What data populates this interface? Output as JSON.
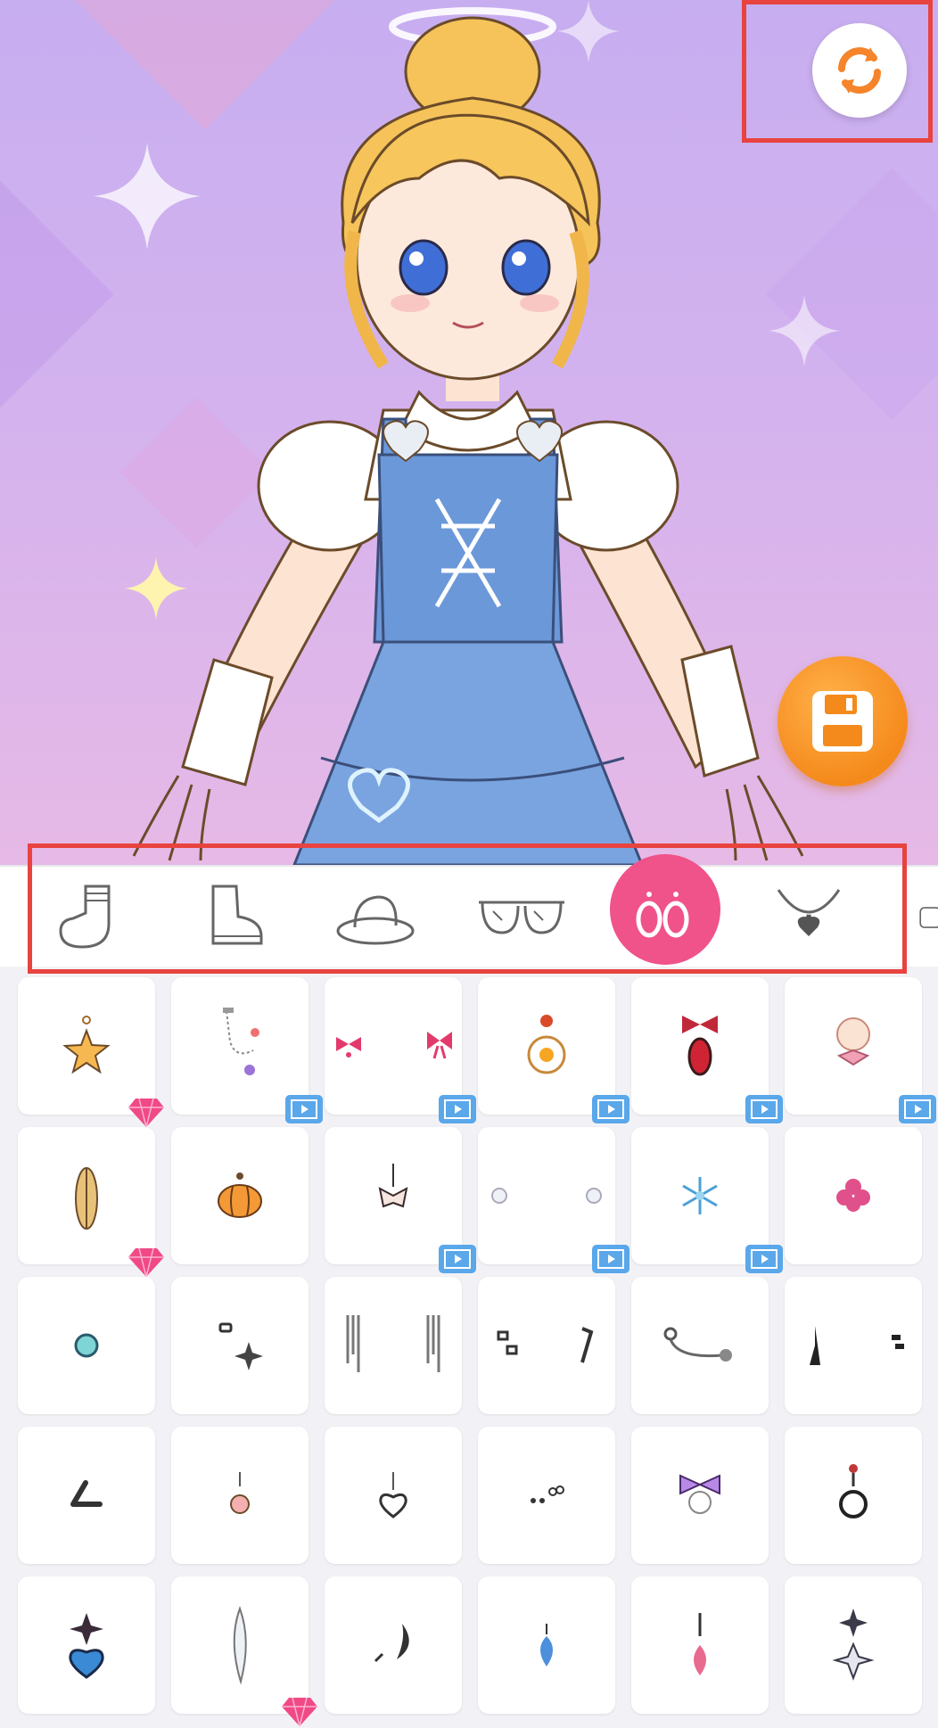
{
  "app": {
    "screen": "dress-up-accessories"
  },
  "toolbar": {
    "refresh_icon": "refresh-icon",
    "save_icon": "save-icon"
  },
  "tabs": [
    {
      "id": "socks",
      "icon": "sock-icon",
      "active": false
    },
    {
      "id": "shoes",
      "icon": "boot-icon",
      "active": false
    },
    {
      "id": "hats",
      "icon": "hat-icon",
      "active": false
    },
    {
      "id": "glasses",
      "icon": "glasses-icon",
      "active": false
    },
    {
      "id": "earrings",
      "icon": "earrings-icon",
      "active": true
    },
    {
      "id": "necklaces",
      "icon": "necklace-icon",
      "active": false
    }
  ],
  "colors": {
    "accent": "#f0528a",
    "save": "#f58a1c",
    "highlight": "#e8433f",
    "video_badge": "#5aa7ea",
    "gem": "#f04a86"
  },
  "items": [
    [
      {
        "icon": "star-earring-icon",
        "badge": "gem"
      },
      {
        "icon": "chain-earring-icon",
        "badge": "video"
      },
      {
        "icon": "bow-earring-icon",
        "badge": "video"
      },
      {
        "icon": "flower-earring-icon",
        "badge": "video"
      },
      {
        "icon": "ruby-earring-icon",
        "badge": "video"
      },
      {
        "icon": "pearl-bow-earring-icon",
        "badge": "video"
      }
    ],
    [
      {
        "icon": "feather-earring-icon",
        "badge": "gem"
      },
      {
        "icon": "pumpkin-earring-icon",
        "badge": ""
      },
      {
        "icon": "butterfly-earring-icon",
        "badge": "video"
      },
      {
        "icon": "pearl-stud-icon",
        "badge": "video"
      },
      {
        "icon": "snowflake-earring-icon",
        "badge": "video"
      },
      {
        "icon": "clover-earring-icon",
        "badge": ""
      }
    ],
    [
      {
        "icon": "teal-stud-icon",
        "badge": ""
      },
      {
        "icon": "sparkle-earring-icon",
        "badge": ""
      },
      {
        "icon": "drip-earring-icon",
        "badge": ""
      },
      {
        "icon": "note-earring-icon",
        "badge": ""
      },
      {
        "icon": "hoop-bead-icon",
        "badge": ""
      },
      {
        "icon": "black-dangle-icon",
        "badge": ""
      }
    ],
    [
      {
        "icon": "cuff-earring-icon",
        "badge": ""
      },
      {
        "icon": "paw-earring-icon",
        "badge": ""
      },
      {
        "icon": "heart-dangle-icon",
        "badge": ""
      },
      {
        "icon": "dot-cluster-icon",
        "badge": ""
      },
      {
        "icon": "bunny-bow-icon",
        "badge": ""
      },
      {
        "icon": "ring-drop-icon",
        "badge": ""
      }
    ],
    [
      {
        "icon": "blue-heart-drop-icon",
        "badge": ""
      },
      {
        "icon": "quill-earring-icon",
        "badge": "gem"
      },
      {
        "icon": "moon-earring-icon",
        "badge": ""
      },
      {
        "icon": "blue-flame-icon",
        "badge": ""
      },
      {
        "icon": "pink-drop-icon",
        "badge": ""
      },
      {
        "icon": "double-star-icon",
        "badge": ""
      }
    ]
  ]
}
